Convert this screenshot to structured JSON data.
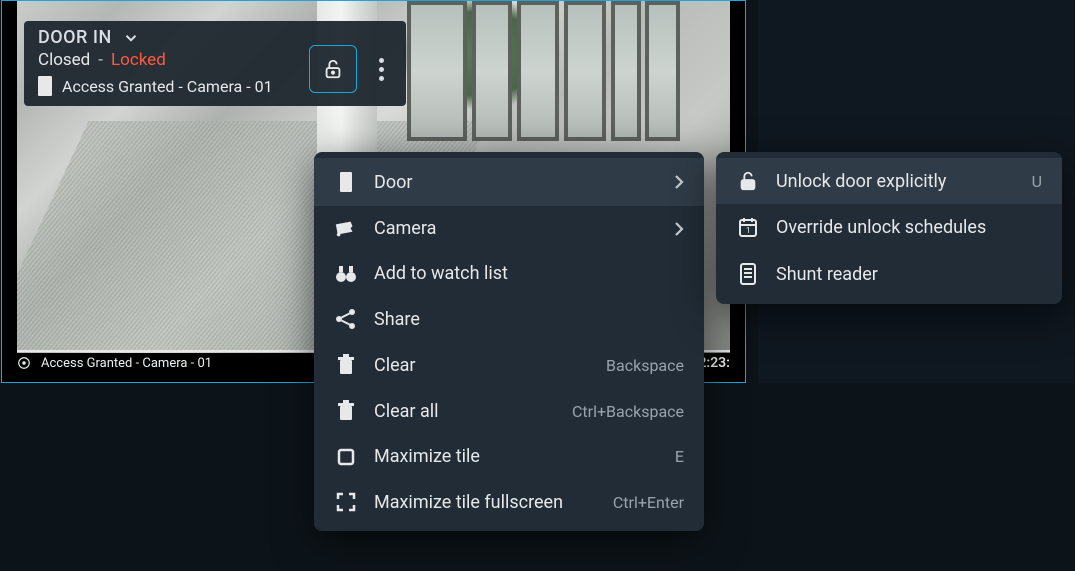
{
  "tile": {
    "title": "DOOR IN",
    "state_closed": "Closed",
    "state_locked": "Locked",
    "access_line": "Access Granted - Camera - 01",
    "bar_label": "Access Granted - Camera - 01",
    "timestamp": "2:23:"
  },
  "colors": {
    "locked": "#ff5a3d",
    "accent": "#1ca7d8"
  },
  "context_menu": {
    "items": [
      {
        "label": "Door",
        "shortcut": "",
        "hasSubmenu": true
      },
      {
        "label": "Camera",
        "shortcut": "",
        "hasSubmenu": true
      },
      {
        "label": "Add to watch list",
        "shortcut": "",
        "hasSubmenu": false
      },
      {
        "label": "Share",
        "shortcut": "",
        "hasSubmenu": false
      },
      {
        "label": "Clear",
        "shortcut": "Backspace",
        "hasSubmenu": false
      },
      {
        "label": "Clear all",
        "shortcut": "Ctrl+Backspace",
        "hasSubmenu": false
      },
      {
        "label": "Maximize tile",
        "shortcut": "E",
        "hasSubmenu": false
      },
      {
        "label": "Maximize tile fullscreen",
        "shortcut": "Ctrl+Enter",
        "hasSubmenu": false
      }
    ]
  },
  "door_submenu": {
    "items": [
      {
        "label": "Unlock door explicitly",
        "shortcut": "U"
      },
      {
        "label": "Override unlock schedules",
        "shortcut": ""
      },
      {
        "label": "Shunt reader",
        "shortcut": ""
      }
    ]
  }
}
